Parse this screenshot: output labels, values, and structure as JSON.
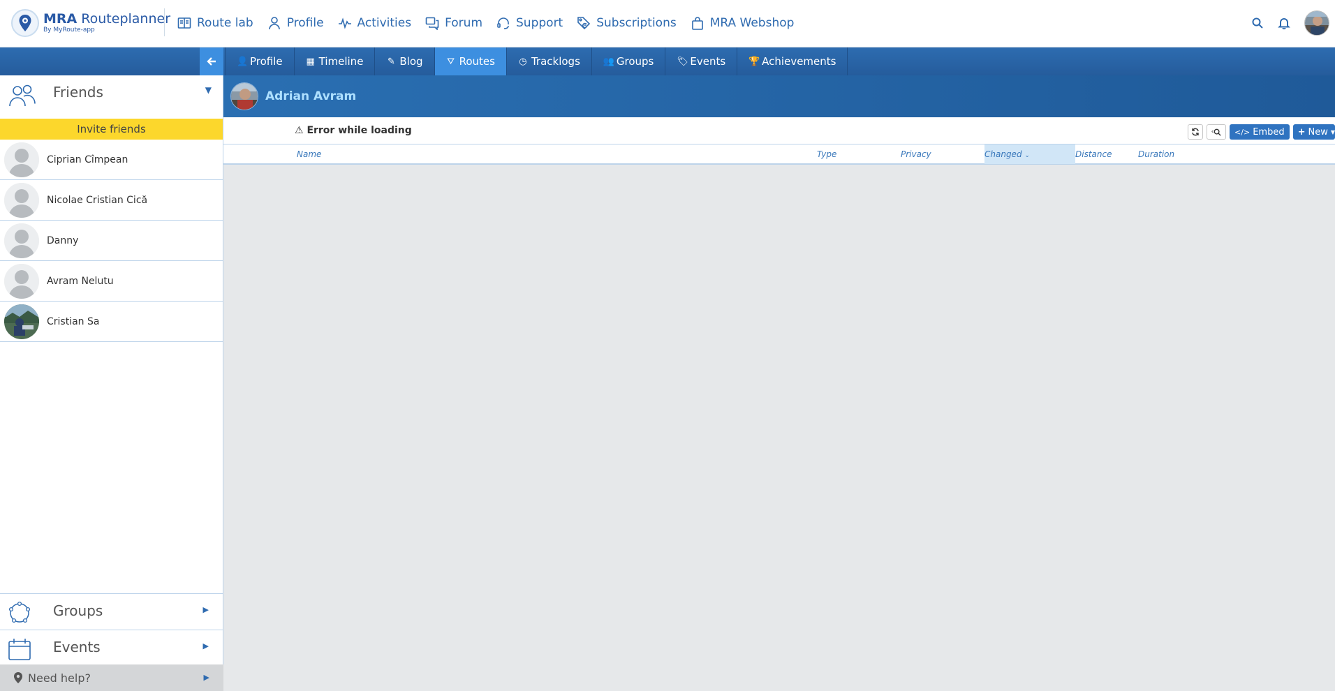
{
  "app": {
    "logo_title_bold": "MRA",
    "logo_title_rest": " Routeplanner",
    "logo_sub": "By MyRoute-app"
  },
  "main_nav": [
    {
      "label": "Route lab",
      "icon": "map-book-icon"
    },
    {
      "label": "Profile",
      "icon": "person-icon"
    },
    {
      "label": "Activities",
      "icon": "pulse-icon"
    },
    {
      "label": "Forum",
      "icon": "chat-icon"
    },
    {
      "label": "Support",
      "icon": "headset-icon"
    },
    {
      "label": "Subscriptions",
      "icon": "tag-euro-icon"
    },
    {
      "label": "MRA Webshop",
      "icon": "shopping-bag-icon"
    }
  ],
  "sub_nav": [
    {
      "label": "Profile",
      "icon": "user-icon",
      "glyph": "👤",
      "active": false
    },
    {
      "label": "Timeline",
      "icon": "calendar-icon",
      "glyph": "▦",
      "active": false
    },
    {
      "label": "Blog",
      "icon": "pencil-icon",
      "glyph": "✎",
      "active": false
    },
    {
      "label": "Routes",
      "icon": "road-icon",
      "glyph": "⛛",
      "active": true
    },
    {
      "label": "Tracklogs",
      "icon": "clock-icon",
      "glyph": "◷",
      "active": false
    },
    {
      "label": "Groups",
      "icon": "users-icon",
      "glyph": "👥",
      "active": false
    },
    {
      "label": "Events",
      "icon": "ticket-icon",
      "glyph": "🏷",
      "active": false
    },
    {
      "label": "Achievements",
      "icon": "trophy-icon",
      "glyph": "🏆",
      "active": false
    }
  ],
  "sidebar": {
    "friends_label": "Friends",
    "invite_label": "Invite friends",
    "friends": [
      {
        "name": "Ciprian Cîmpean",
        "photo": false
      },
      {
        "name": "Nicolae Cristian Cică",
        "photo": false
      },
      {
        "name": "Danny",
        "photo": false
      },
      {
        "name": "Avram Nelutu",
        "photo": false
      },
      {
        "name": "Cristian Sa",
        "photo": true
      }
    ],
    "groups_label": "Groups",
    "events_label": "Events",
    "help_label": "Need help?"
  },
  "profile": {
    "name": "Adrian Avram"
  },
  "list": {
    "error": "Error while loading",
    "embed_label": "Embed",
    "new_label": "New",
    "columns": [
      "Name",
      "Type",
      "Privacy",
      "Changed",
      "Distance",
      "Duration"
    ],
    "sorted_column": "Changed"
  },
  "colors": {
    "brand_blue": "#2f6bb0",
    "active_tab": "#3d8fe0",
    "invite_yellow": "#fcd72c",
    "username": "#aee0ff"
  }
}
